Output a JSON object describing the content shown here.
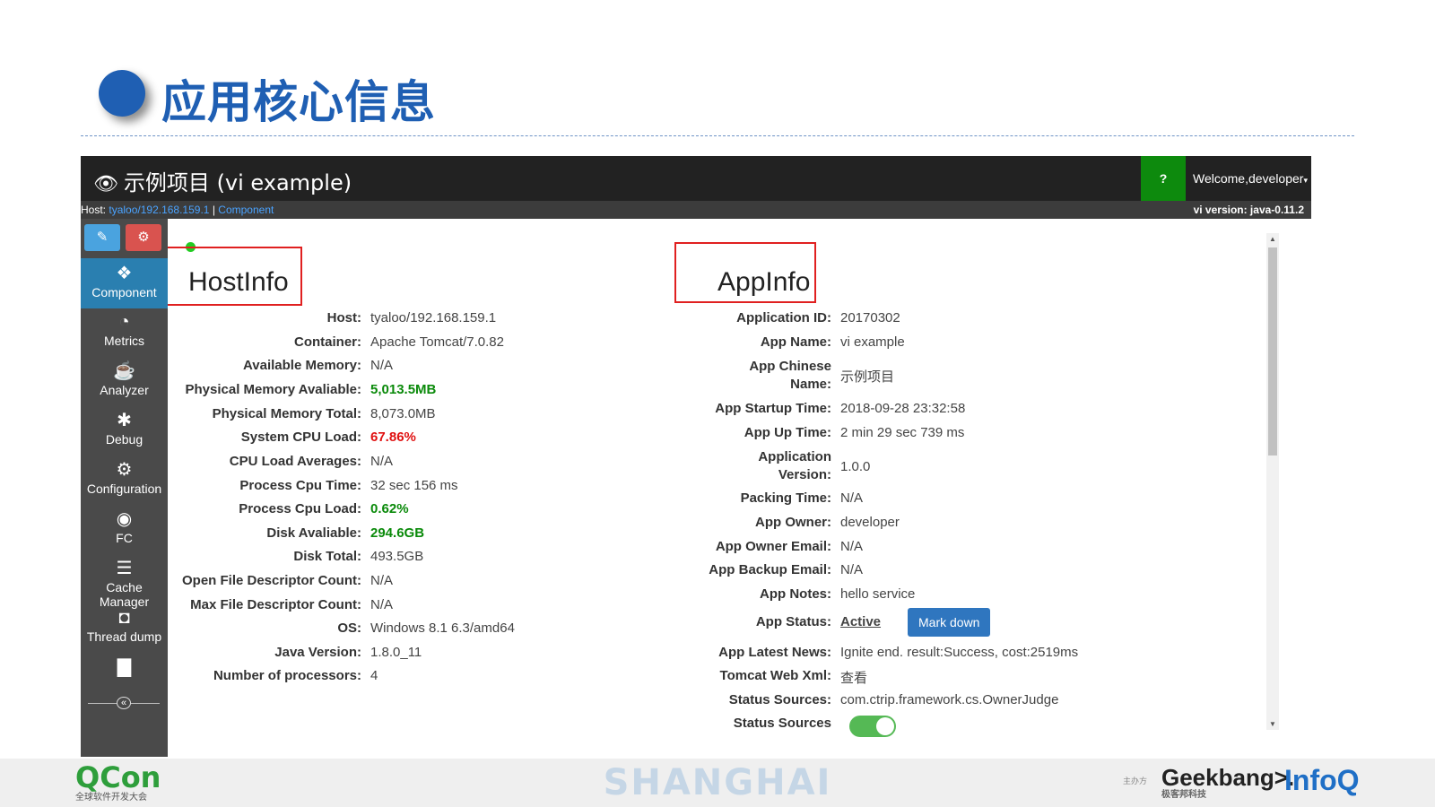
{
  "slide": {
    "title": "应用核心信息"
  },
  "app": {
    "brand": "示例项目 (vi example)",
    "help_label": "?",
    "welcome": "Welcome,developer",
    "infobar": {
      "host_prefix": "Host:",
      "host_link": "tyaloo/192.168.159.1",
      "separator": "|",
      "component_link": "Component",
      "version": "vi version: java-0.11.2"
    }
  },
  "sidebar": {
    "tools": [
      {
        "icon": "pencil-icon",
        "glyph": "✎"
      },
      {
        "icon": "cogs-icon",
        "glyph": "⚙"
      }
    ],
    "items": [
      {
        "label": "Component",
        "icon": "component-icon",
        "glyph": "❖"
      },
      {
        "label": "Metrics",
        "icon": "dashboard-icon",
        "glyph": "◔"
      },
      {
        "label": "Analyzer",
        "icon": "coffee-icon",
        "glyph": "☕"
      },
      {
        "label": "Debug",
        "icon": "bug-icon",
        "glyph": "✱"
      },
      {
        "label": "Configuration",
        "icon": "gears-icon",
        "glyph": "⚙"
      },
      {
        "label": "FC",
        "icon": "toggle-icon",
        "glyph": "◉"
      },
      {
        "label": "Cache Manager",
        "icon": "database-icon",
        "glyph": "☰"
      },
      {
        "label": "Thread dump",
        "icon": "camera-icon",
        "glyph": "◘"
      },
      {
        "label": "",
        "icon": "file-icon",
        "glyph": "▇"
      }
    ],
    "collapse_glyph": "«"
  },
  "host_info": {
    "title": "HostInfo",
    "rows": [
      {
        "label": "Host:",
        "value": "tyaloo/192.168.159.1"
      },
      {
        "label": "Container:",
        "value": "Apache Tomcat/7.0.82"
      },
      {
        "label": "Available Memory:",
        "value": "N/A"
      },
      {
        "label": "Physical Memory Avaliable:",
        "value": "5,013.5MB",
        "status": "green"
      },
      {
        "label": "Physical Memory Total:",
        "value": "8,073.0MB"
      },
      {
        "label": "System CPU Load:",
        "value": "67.86%",
        "status": "red"
      },
      {
        "label": "CPU Load Averages:",
        "value": "N/A"
      },
      {
        "label": "Process Cpu Time:",
        "value": "32 sec 156 ms"
      },
      {
        "label": "Process Cpu Load:",
        "value": "0.62%",
        "status": "green"
      },
      {
        "label": "Disk Avaliable:",
        "value": "294.6GB",
        "status": "green"
      },
      {
        "label": "Disk Total:",
        "value": "493.5GB"
      },
      {
        "label": "Open File Descriptor Count:",
        "value": "N/A"
      },
      {
        "label": "Max File Descriptor Count:",
        "value": "N/A"
      },
      {
        "label": "OS:",
        "value": "Windows 8.1 6.3/amd64"
      },
      {
        "label": "Java Version:",
        "value": "1.8.0_11"
      },
      {
        "label": "Number of processors:",
        "value": "4"
      }
    ]
  },
  "app_info": {
    "title": "AppInfo",
    "application_id": {
      "label": "Application ID:",
      "value": "20170302"
    },
    "app_name": {
      "label": "App Name:",
      "value": "vi example"
    },
    "app_chinese_name": {
      "label1": "App Chinese",
      "label2": "Name:",
      "value": "示例项目"
    },
    "startup_time": {
      "label": "App Startup Time:",
      "value": "2018-09-28 23:32:58"
    },
    "up_time": {
      "label": "App Up Time:",
      "value": "2 min 29 sec 739 ms"
    },
    "app_version": {
      "label1": "Application",
      "label2": "Version:",
      "value": "1.0.0"
    },
    "packing_time": {
      "label": "Packing Time:",
      "value": "N/A"
    },
    "owner": {
      "label": "App Owner:",
      "value": "developer"
    },
    "owner_email": {
      "label": "App Owner Email:",
      "value": "N/A"
    },
    "backup_email": {
      "label": "App Backup Email:",
      "value": "N/A"
    },
    "notes": {
      "label": "App Notes:",
      "value": "hello service"
    },
    "status": {
      "label": "App Status:",
      "value": "Active",
      "button": "Mark down"
    },
    "latest_news": {
      "label": "App Latest News:",
      "value": "Ignite end. result:Success, cost:2519ms"
    },
    "tomcat_xml": {
      "label": "Tomcat Web Xml:",
      "value": "查看"
    },
    "status_sources": {
      "label": "Status Sources:",
      "value": "com.ctrip.framework.cs.OwnerJudge"
    },
    "status_sources_toggle": {
      "label": "Status Sources",
      "on": true
    }
  },
  "footer": {
    "qcon": "QCon",
    "qcon_sub": "全球软件开发大会",
    "city": "SHANGHAI",
    "sponsor": "主办方",
    "geekbang": "Geekbang>.",
    "geekbang_sub": "极客邦科技",
    "infoq": "InfoQ"
  },
  "colors": {
    "accent": "#1f5fb3",
    "green": "#0a8a0a",
    "red": "#e01010",
    "active_nav": "#2a7fb0"
  }
}
